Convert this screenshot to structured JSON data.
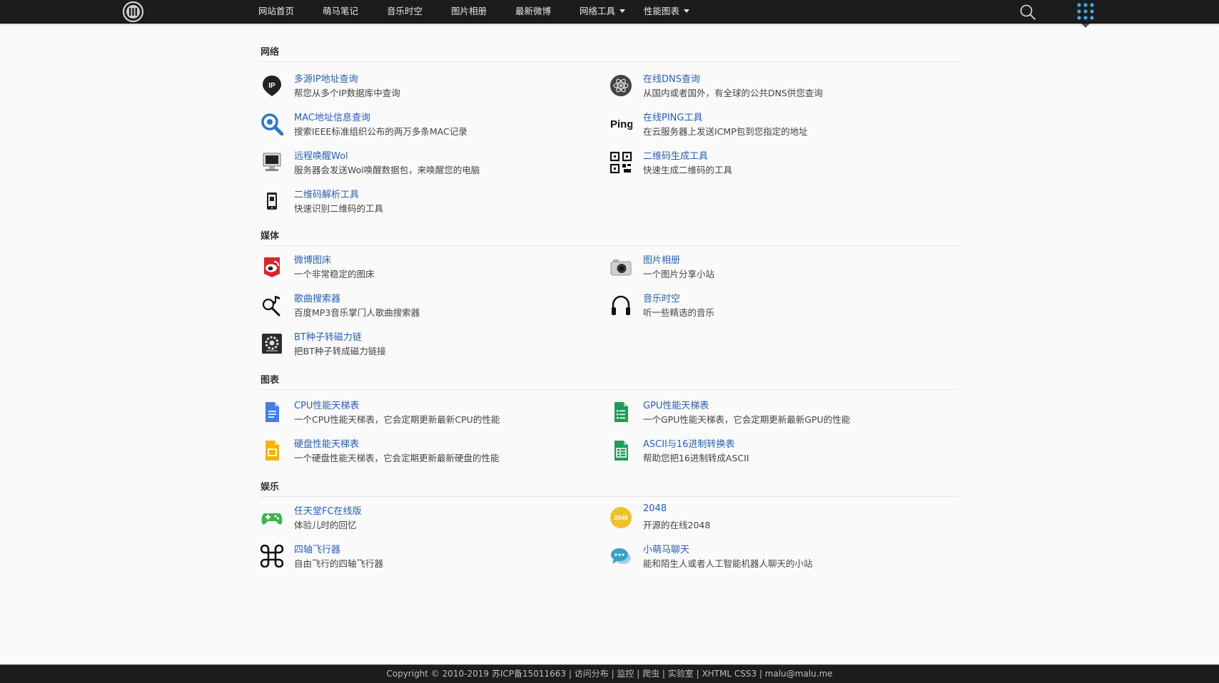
{
  "nav": {
    "logo": "logo-icon",
    "items": [
      {
        "label": "网站首页"
      },
      {
        "label": "萌马笔记"
      },
      {
        "label": "音乐时空"
      },
      {
        "label": "图片相册"
      },
      {
        "label": "最新微博"
      },
      {
        "label": "网络工具",
        "dropdown": true
      },
      {
        "label": "性能图表",
        "dropdown": true
      }
    ],
    "search_icon": "search-icon",
    "apps_icon": "apps-grid-icon",
    "accent": "#3ea7e8"
  },
  "sections": [
    {
      "title": "网络",
      "tools": [
        {
          "name": "多源IP地址查询",
          "desc": "帮您从多个IP数据库中查询",
          "icon": "ip-pin-icon"
        },
        {
          "name": "在线DNS查询",
          "desc": "从国内或者国外，有全球的公共DNS供您查询",
          "icon": "atom-icon"
        },
        {
          "name": "MAC地址信息查询",
          "desc": "搜索IEEE标准组织公布的两万多条MAC记录",
          "icon": "magnifier-gear-icon"
        },
        {
          "name": "在线PING工具",
          "desc": "在云服务器上发送ICMP包到您指定的地址",
          "icon": "ping-text-icon",
          "icon_text": "Ping"
        },
        {
          "name": "远程唤醒Wol",
          "desc": "服务器会发送Wol唤醒数据包，来唤醒您的电脑",
          "icon": "computer-icon"
        },
        {
          "name": "二维码生成工具",
          "desc": "快速生成二维码的工具",
          "icon": "qr-code-icon"
        },
        {
          "name": "二维码解析工具",
          "desc": "快速识别二维码的工具",
          "icon": "phone-scan-icon"
        }
      ]
    },
    {
      "title": "媒体",
      "tools": [
        {
          "name": "微博图床",
          "desc": "一个非常稳定的图床",
          "icon": "weibo-icon"
        },
        {
          "name": "图片相册",
          "desc": "一个图片分享小站",
          "icon": "camera-icon"
        },
        {
          "name": "歌曲搜索器",
          "desc": "百度MP3音乐掌门人歌曲搜索器",
          "icon": "music-search-icon"
        },
        {
          "name": "音乐时空",
          "desc": "听一些精选的音乐",
          "icon": "headphones-icon"
        },
        {
          "name": "BT种子转磁力链",
          "desc": "把BT种子转成磁力链接",
          "icon": "torrent-gear-icon"
        }
      ]
    },
    {
      "title": "图表",
      "tools": [
        {
          "name": "CPU性能天梯表",
          "desc": "一个CPU性能天梯表，它会定期更新最新CPU的性能",
          "icon": "doc-blue-icon"
        },
        {
          "name": "GPU性能天梯表",
          "desc": "一个GPU性能天梯表，它会定期更新最新GPU的性能",
          "icon": "sheet-green-list-icon"
        },
        {
          "name": "硬盘性能天梯表",
          "desc": "一个硬盘性能天梯表，它会定期更新最新硬盘的性能",
          "icon": "slides-yellow-icon"
        },
        {
          "name": "ASCII与16进制转换表",
          "desc": "帮助您把16进制转成ASCII",
          "icon": "sheet-green-grid-icon"
        }
      ]
    },
    {
      "title": "娱乐",
      "tools": [
        {
          "name": "任天堂FC在线版",
          "desc": "体验儿时的回忆",
          "icon": "gamepad-icon"
        },
        {
          "name": "2048",
          "desc": "开源的在线2048",
          "icon": "badge-2048-icon",
          "icon_text": "2048"
        },
        {
          "name": "四轴飞行器",
          "desc": "自由飞行的四轴飞行器",
          "icon": "command-icon"
        },
        {
          "name": "小萌马聊天",
          "desc": "能和陌生人或者人工智能机器人聊天的小站",
          "icon": "chat-bubbles-icon"
        }
      ]
    }
  ],
  "footer": {
    "text": "Copyright © 2010-2019 苏ICP备15011663 | 访问分布 | 监控 | 爬虫 | 实验室 | XHTML CSS3 | malu@malu.me"
  }
}
